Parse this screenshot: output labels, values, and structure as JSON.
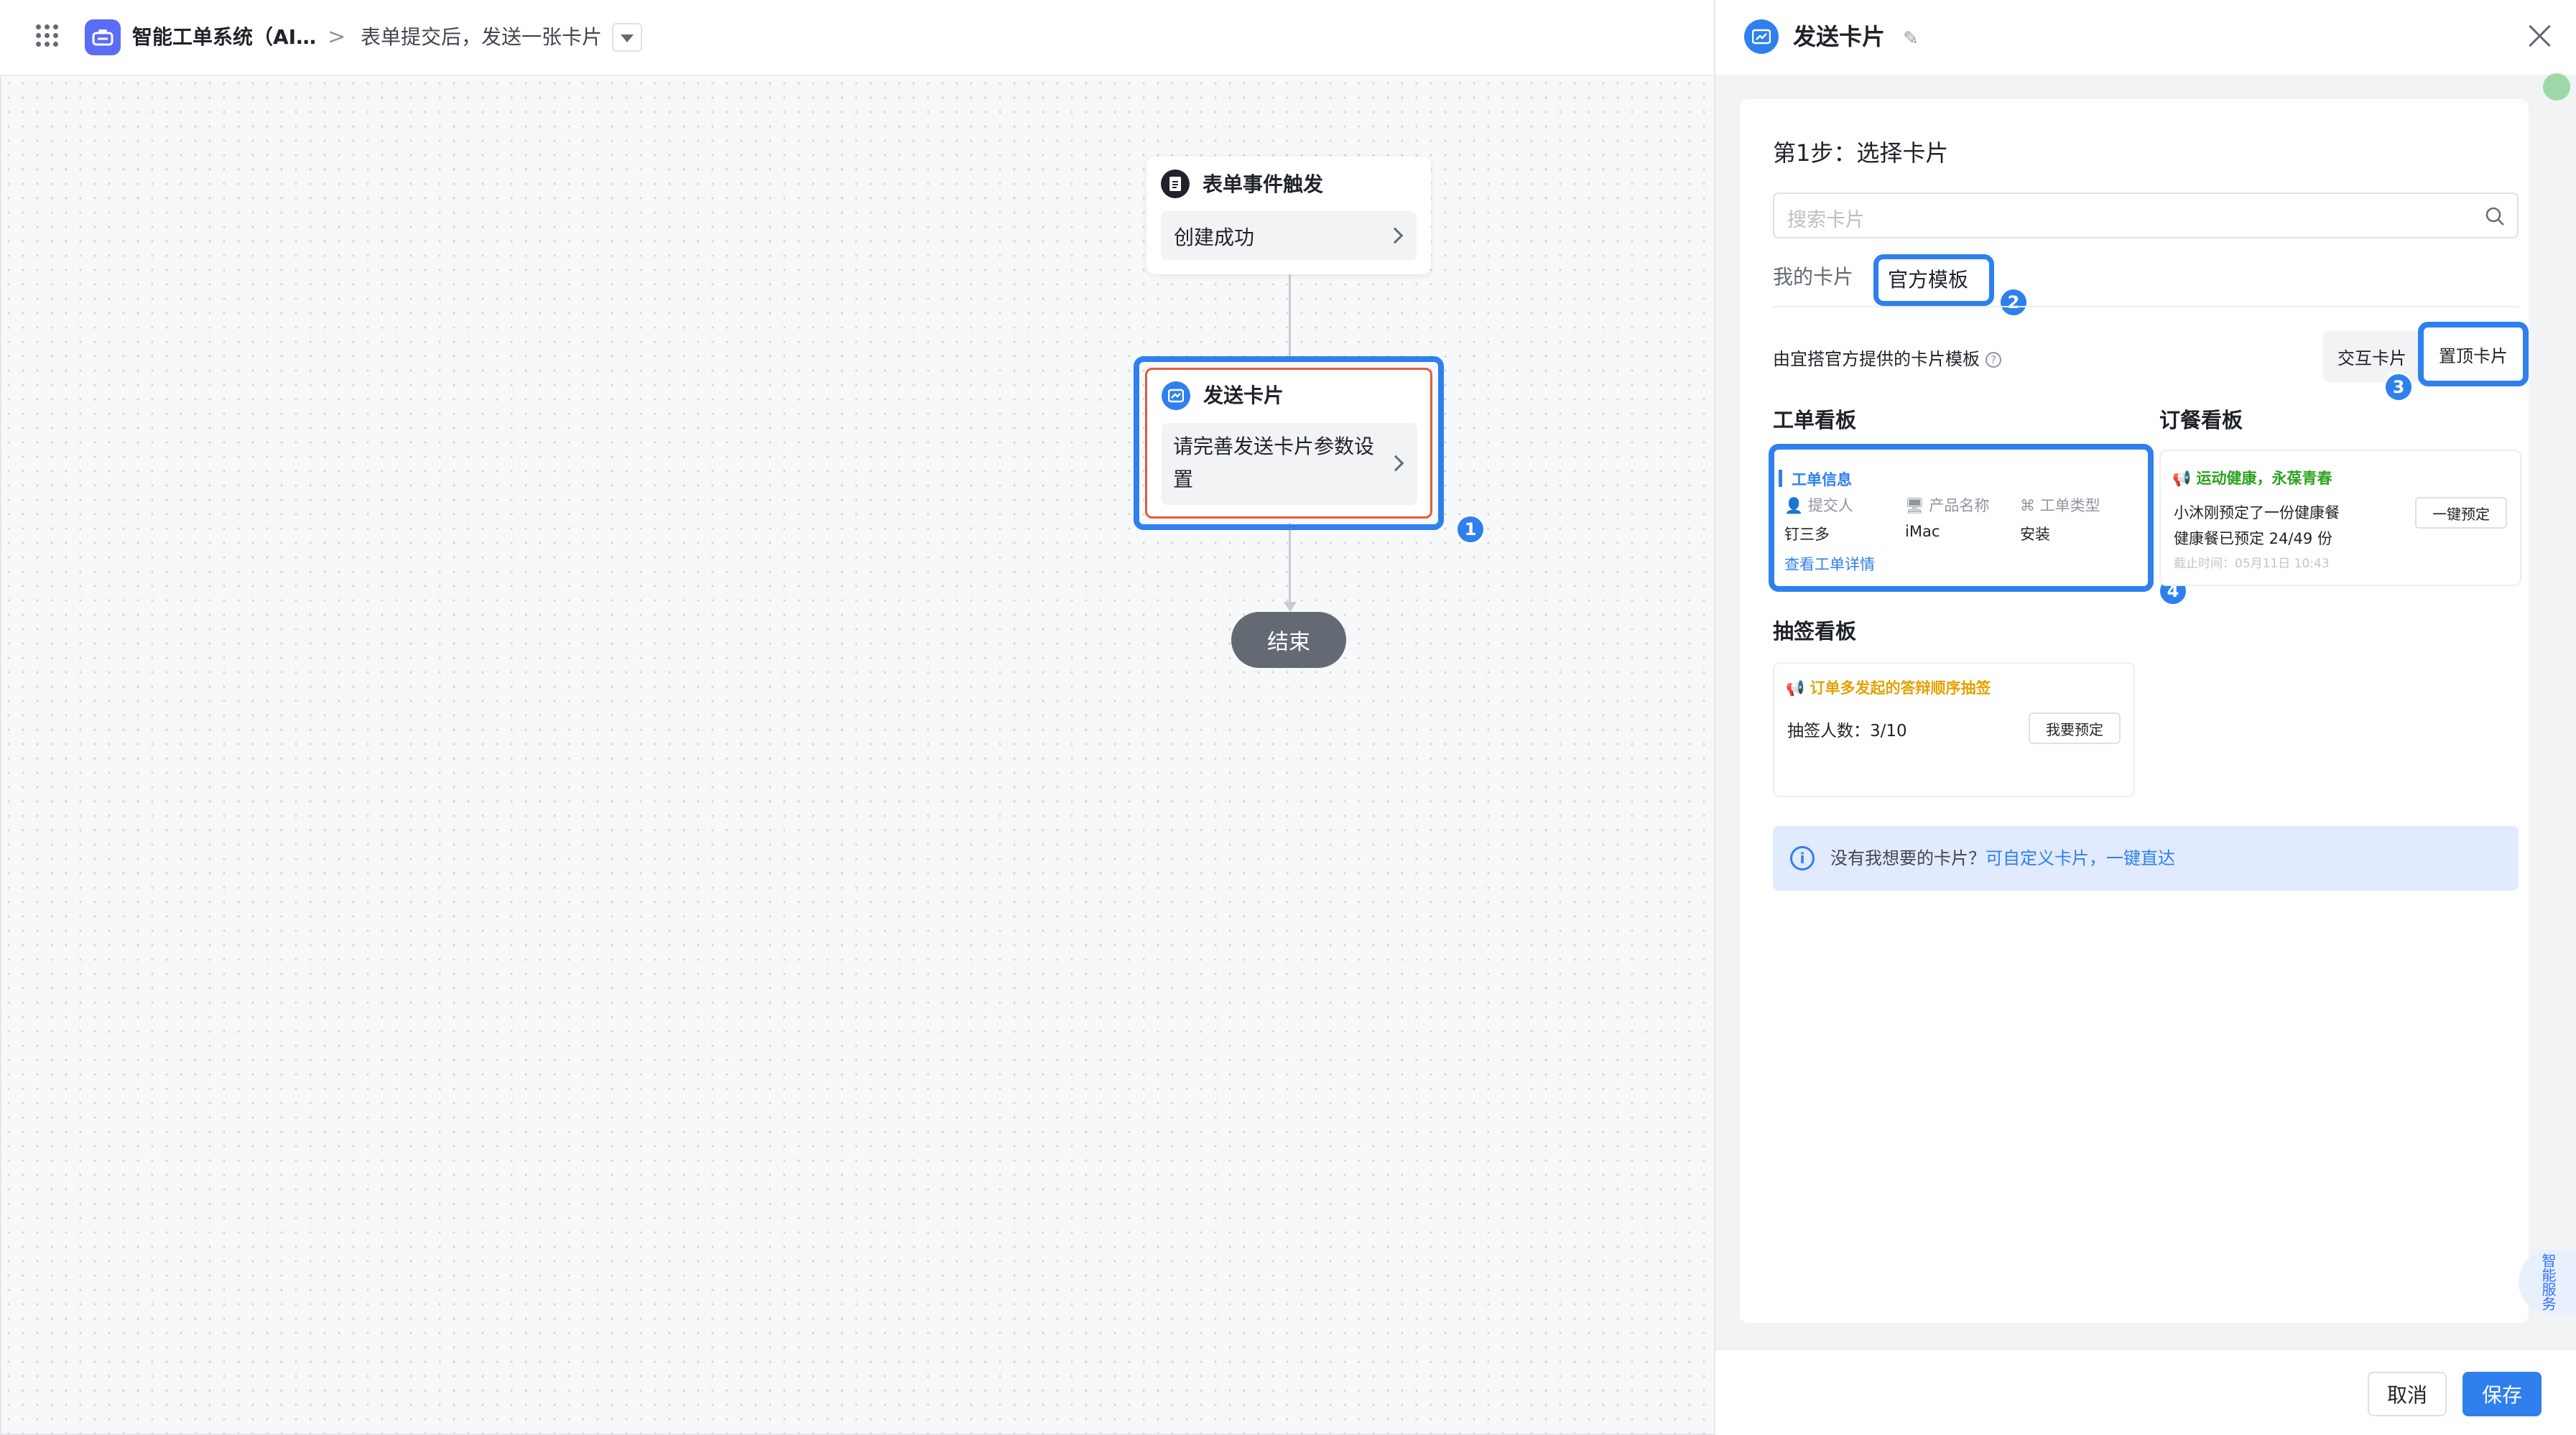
{
  "header": {
    "app_name": "智能工单系统（AI…",
    "separator": ">",
    "page_title": "表单提交后，发送一张卡片"
  },
  "flow": {
    "trigger": {
      "title": "表单事件触发",
      "value": "创建成功"
    },
    "send_card": {
      "title": "发送卡片",
      "value": "请完善发送卡片参数设置"
    },
    "end": {
      "label": "结束"
    },
    "badges": [
      "1",
      "2",
      "3",
      "4"
    ]
  },
  "panel": {
    "title": "发送卡片",
    "step_title": "第1步：选择卡片",
    "search_placeholder": "搜索卡片",
    "tabs": {
      "mine": "我的卡片",
      "official": "官方模板"
    },
    "description": "由宜搭官方提供的卡片模板",
    "filters": [
      "交互卡片",
      "置顶卡片"
    ],
    "sections": {
      "ticket": {
        "heading": "工单看板",
        "card": {
          "title": "工单信息",
          "fields": [
            {
              "label": "提交人",
              "value": "钉三多",
              "icon": "user-icon"
            },
            {
              "label": "产品名称",
              "value": "iMac",
              "icon": "monitor-icon"
            },
            {
              "label": "工单类型",
              "value": "安装",
              "icon": "grid-icon"
            }
          ],
          "link": "查看工单详情"
        }
      },
      "meal": {
        "heading": "订餐看板",
        "card": {
          "title": "运动健康，永葆青春",
          "line1": "小沐刚预定了一份健康餐",
          "line2": "健康餐已预定 24/49 份",
          "deadline": "截止时间：05月11日 10:43",
          "button": "一键预定"
        }
      },
      "lottery": {
        "heading": "抽签看板",
        "card": {
          "title": "订单多发起的答辩顺序抽签",
          "count_text": "抽签人数：3/10",
          "button": "我要预定"
        }
      }
    },
    "info": {
      "text": "没有我想要的卡片？",
      "link": "可自定义卡片，一键直达"
    },
    "assistant": "智能服务",
    "footer": {
      "cancel": "取消",
      "save": "保存"
    }
  },
  "colors": {
    "accent": "#2f80ed",
    "highlight_red": "#e25b3d",
    "success_green": "#2ea121",
    "warning_orange": "#e4a200"
  }
}
